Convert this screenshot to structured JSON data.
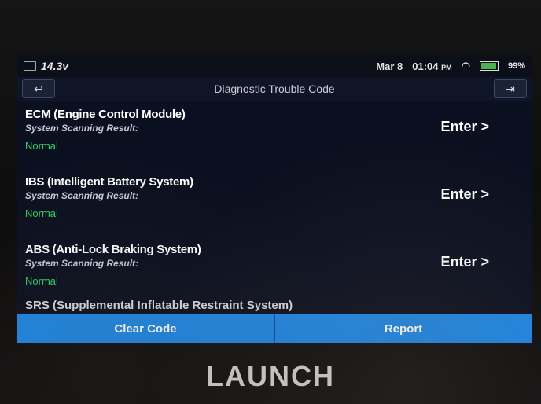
{
  "status": {
    "voltage": "14.3v",
    "date": "Mar 8",
    "time": "01:04",
    "ampm": "PM",
    "battery": "99%"
  },
  "header": {
    "title": "Diagnostic Trouble Code"
  },
  "systems": [
    {
      "title": "ECM (Engine Control Module)",
      "subtitle": "System Scanning Result:",
      "status": "Normal",
      "action": "Enter >"
    },
    {
      "title": "IBS (Intelligent Battery System)",
      "subtitle": "System Scanning Result:",
      "status": "Normal",
      "action": "Enter >"
    },
    {
      "title": "ABS (Anti-Lock Braking System)",
      "subtitle": "System Scanning Result:",
      "status": "Normal",
      "action": "Enter >"
    }
  ],
  "partial_item": "SRS (Supplemental Inflatable Restraint System)",
  "footer": {
    "clear_label": "Clear Code",
    "report_label": "Report"
  },
  "brand": "LAUNCH",
  "colors": {
    "accent": "#1e88e5",
    "normal": "#2fd067"
  }
}
